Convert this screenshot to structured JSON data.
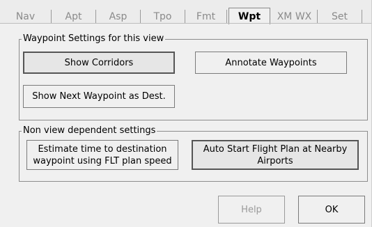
{
  "tabs": [
    {
      "label": "Nav"
    },
    {
      "label": "Apt"
    },
    {
      "label": "Asp"
    },
    {
      "label": "Tpo"
    },
    {
      "label": "Fmt"
    },
    {
      "label": "Wpt",
      "active": true
    },
    {
      "label": "XM WX"
    },
    {
      "label": "Set"
    }
  ],
  "waypoint_group": {
    "legend": "Waypoint Settings for this view",
    "show_corridors": "Show Corridors",
    "annotate_waypoints": "Annotate Waypoints",
    "show_next_waypoint": "Show Next Waypoint as Dest."
  },
  "nonview_group": {
    "legend": "Non view dependent settings",
    "estimate_time_line1": "Estimate time to destination",
    "estimate_time_line2": "waypoint using FLT plan speed",
    "auto_start_line1": "Auto Start Flight Plan at Nearby",
    "auto_start_line2": "Airports"
  },
  "footer": {
    "help_label": "Help",
    "ok_label": "OK"
  }
}
